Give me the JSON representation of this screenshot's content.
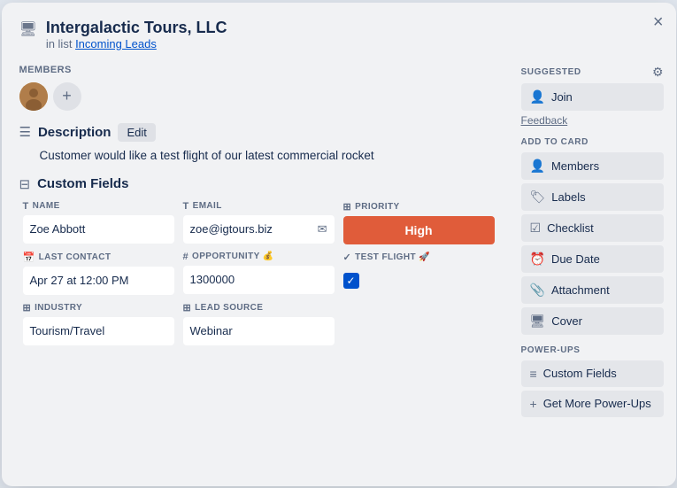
{
  "modal": {
    "title": "Intergalactic Tours, LLC",
    "subtitle": "in list",
    "list_link": "Incoming Leads",
    "close_label": "×"
  },
  "members": {
    "label": "Members",
    "add_label": "+"
  },
  "description": {
    "label": "Description",
    "edit_label": "Edit",
    "text": "Customer would like a test flight of our latest commercial rocket"
  },
  "custom_fields": {
    "label": "Custom Fields",
    "fields": [
      {
        "id": "name",
        "label": "NAME",
        "icon": "T",
        "value": "Zoe Abbott",
        "type": "text"
      },
      {
        "id": "email",
        "label": "EMAIL",
        "icon": "T",
        "value": "zoe@igtours.biz",
        "type": "email"
      },
      {
        "id": "priority",
        "label": "PRIORITY",
        "icon": "≡≡",
        "value": "High",
        "type": "priority"
      },
      {
        "id": "last_contact",
        "label": "LAST CONTACT",
        "icon": "📅",
        "value": "Apr 27 at 12:00 PM",
        "type": "text"
      },
      {
        "id": "opportunity",
        "label": "OPPORTUNITY 💰",
        "icon": "#",
        "value": "1300000",
        "type": "text"
      },
      {
        "id": "test_flight",
        "label": "TEST FLIGHT 🚀",
        "icon": "✓",
        "value": "",
        "type": "checkbox"
      },
      {
        "id": "industry",
        "label": "INDUSTRY",
        "icon": "≡≡",
        "value": "Tourism/Travel",
        "type": "text"
      },
      {
        "id": "lead_source",
        "label": "LEAD SOURCE",
        "icon": "≡≡",
        "value": "Webinar",
        "type": "text"
      }
    ]
  },
  "suggested": {
    "label": "SUGGESTED",
    "join_label": "Join",
    "feedback_label": "Feedback"
  },
  "add_to_card": {
    "label": "ADD TO CARD",
    "items": [
      {
        "id": "members",
        "label": "Members",
        "icon": "👤"
      },
      {
        "id": "labels",
        "label": "Labels",
        "icon": "🏷"
      },
      {
        "id": "checklist",
        "label": "Checklist",
        "icon": "☑"
      },
      {
        "id": "due_date",
        "label": "Due Date",
        "icon": "⏰"
      },
      {
        "id": "attachment",
        "label": "Attachment",
        "icon": "📎"
      },
      {
        "id": "cover",
        "label": "Cover",
        "icon": "🖥"
      }
    ]
  },
  "power_ups": {
    "label": "POWER-UPS",
    "items": [
      {
        "id": "custom_fields",
        "label": "Custom Fields",
        "icon": "≡"
      },
      {
        "id": "get_more",
        "label": "Get More Power-Ups",
        "icon": "+"
      }
    ]
  }
}
